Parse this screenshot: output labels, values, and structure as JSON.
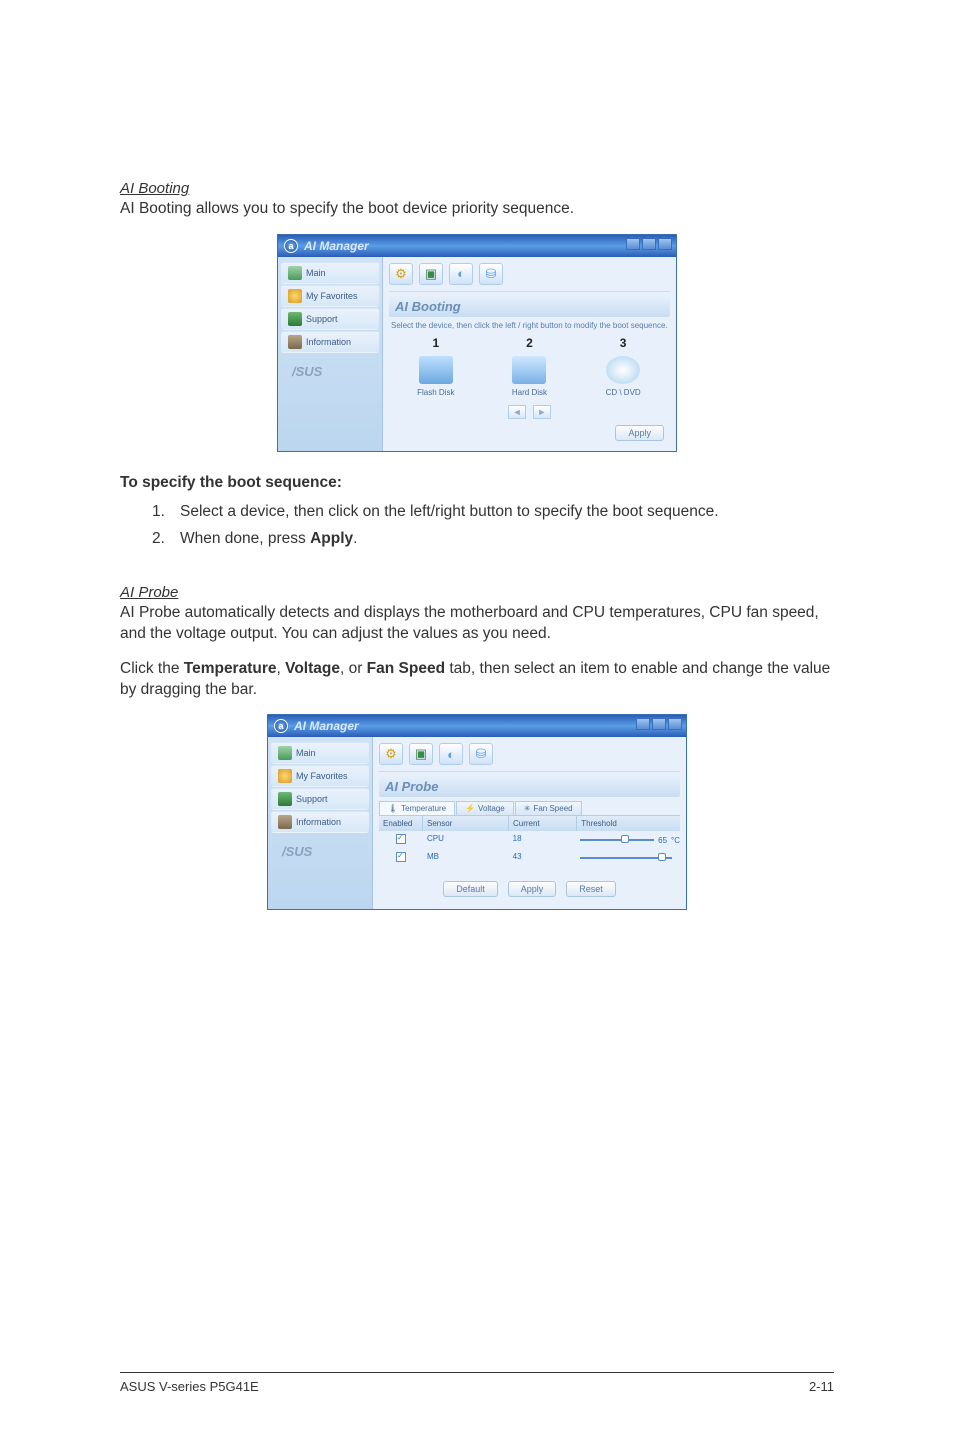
{
  "section1": {
    "heading": "AI Booting",
    "desc": "AI Booting allows you to specify the boot device priority sequence."
  },
  "booting_ss": {
    "title": "AI Manager",
    "sidebar": [
      "Main",
      "My Favorites",
      "Support",
      "Information"
    ],
    "subhead": "AI Booting",
    "instruction": "Select the device, then click the left / right button to modify the boot sequence.",
    "cols": [
      {
        "num": "1",
        "label": "Flash Disk"
      },
      {
        "num": "2",
        "label": "Hard Disk"
      },
      {
        "num": "3",
        "label": "CD \\ DVD"
      }
    ],
    "apply": "Apply"
  },
  "steps": {
    "title": "To specify the boot sequence:",
    "items": [
      {
        "n": "1.",
        "t": "Select a device, then click on the left/right button to specify the boot sequence."
      },
      {
        "n": "2.",
        "t_pre": "When done, press ",
        "t_bold": "Apply",
        "t_post": "."
      }
    ]
  },
  "section2": {
    "heading": "AI Probe",
    "desc": "AI Probe automatically detects and displays the motherboard and CPU temperatures, CPU fan speed, and the voltage output. You can adjust the values as you need.",
    "desc2_pre": "Click the ",
    "desc2_b1": "Temperature",
    "desc2_m1": ", ",
    "desc2_b2": "Voltage",
    "desc2_m2": ", or ",
    "desc2_b3": "Fan Speed",
    "desc2_post": " tab, then select an item to enable and change the value by dragging the bar."
  },
  "probe_ss": {
    "title": "AI Manager",
    "sidebar": [
      "Main",
      "My Favorites",
      "Support",
      "Information"
    ],
    "subhead": "AI Probe",
    "tabs": [
      "Temperature",
      "Voltage",
      "Fan Speed"
    ],
    "headers": {
      "en": "Enabled",
      "sn": "Sensor",
      "cu": "Current",
      "th": "Threshold"
    },
    "rows": [
      {
        "sn": "CPU",
        "cu": "18",
        "th": "65",
        "unit": "°C",
        "knob": 55
      },
      {
        "sn": "MB",
        "cu": "43",
        "th": "",
        "unit": "",
        "knob": 85
      }
    ],
    "btns": [
      "Default",
      "Apply",
      "Reset"
    ]
  },
  "footer": {
    "left": "ASUS V-series P5G41E",
    "right": "2-11"
  }
}
